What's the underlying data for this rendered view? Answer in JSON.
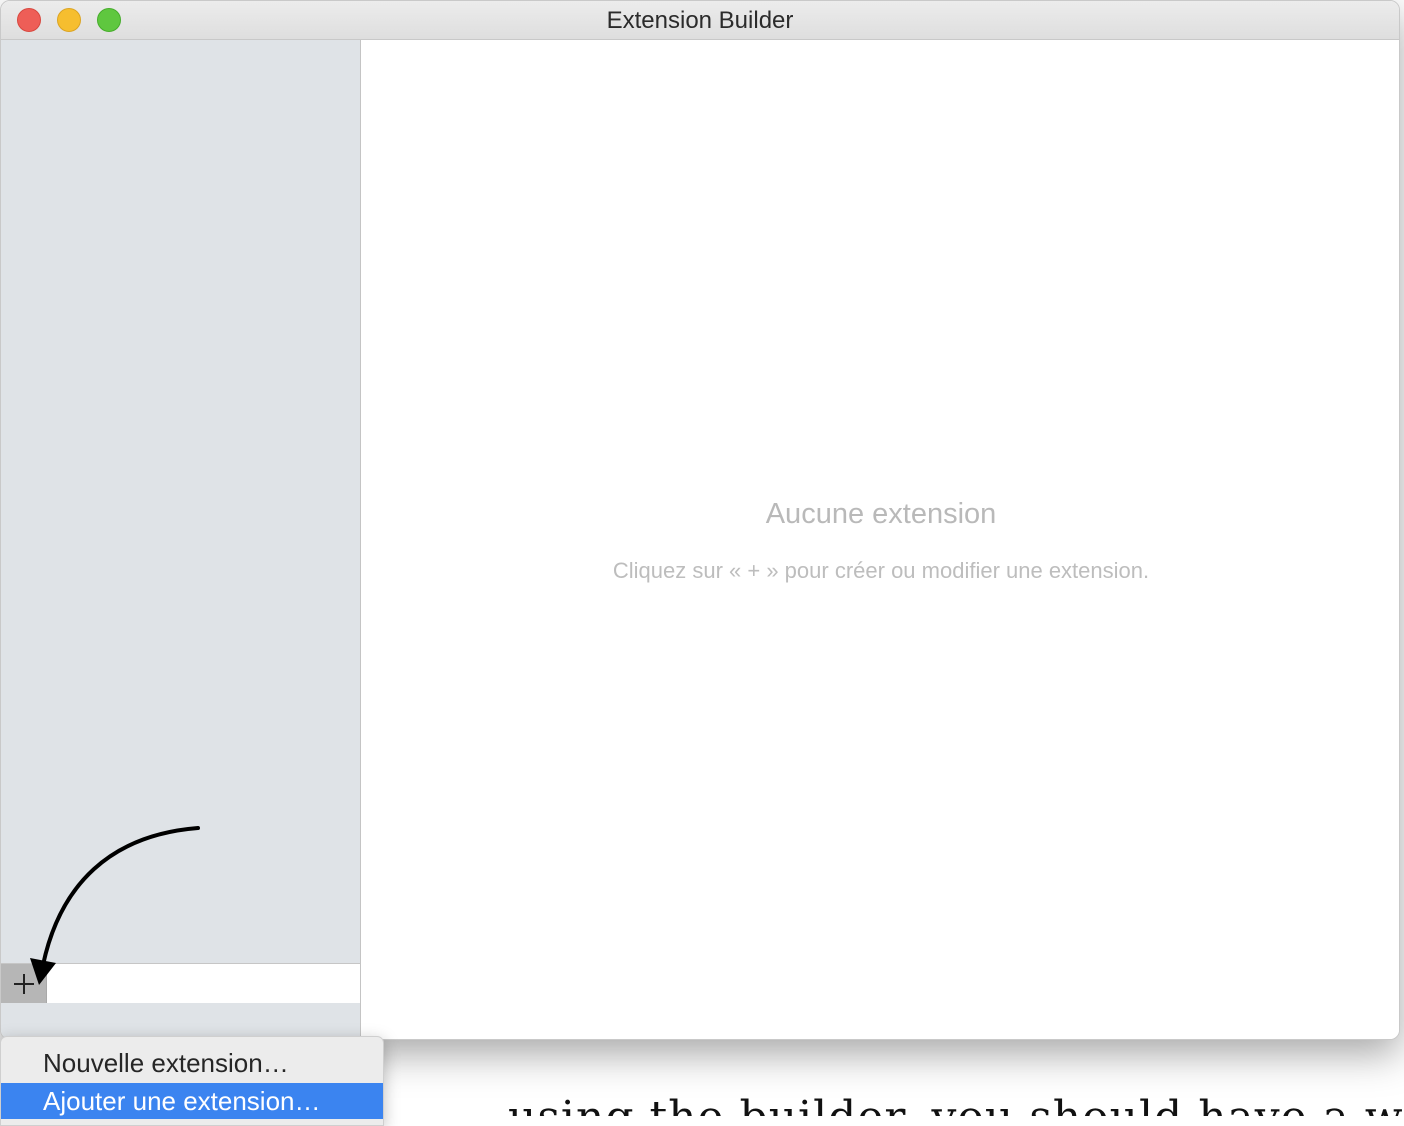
{
  "window": {
    "title": "Extension Builder"
  },
  "sidebar": {
    "add_button_icon": "plus-icon"
  },
  "main": {
    "empty_title": "Aucune extension",
    "empty_subtitle": "Cliquez sur « + » pour créer ou modifier une extension."
  },
  "popup_menu": {
    "items": [
      {
        "label": "Nouvelle extension…",
        "highlighted": false
      },
      {
        "label": "Ajouter une extension…",
        "highlighted": true
      }
    ]
  },
  "background_text": "using the builder, you should have a window showing",
  "colors": {
    "close": "#ee5e57",
    "minimize": "#f6be2f",
    "zoom": "#5fc73f",
    "sidebar_bg": "#dfe3e7",
    "highlight": "#3b84f0"
  }
}
